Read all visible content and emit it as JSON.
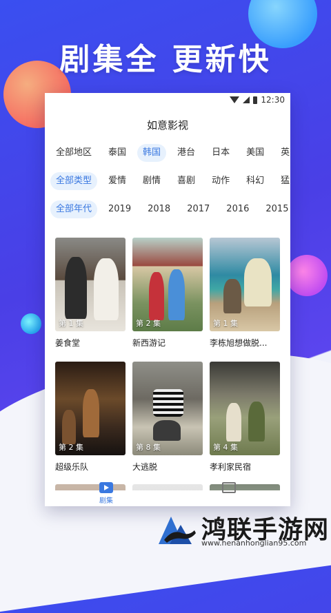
{
  "headline": "剧集全 更新快",
  "status": {
    "time": "12:30"
  },
  "app": {
    "title": "如意影视"
  },
  "filters": {
    "region": [
      "全部地区",
      "泰国",
      "韩国",
      "港台",
      "日本",
      "美国",
      "英"
    ],
    "region_active": "韩国",
    "genre": [
      "全部类型",
      "爱情",
      "剧情",
      "喜剧",
      "动作",
      "科幻",
      "猛"
    ],
    "genre_active": "全部类型",
    "year": [
      "全部年代",
      "2019",
      "2018",
      "2017",
      "2016",
      "2015"
    ],
    "year_active": "全部年代"
  },
  "cards": [
    {
      "title": "姜食堂",
      "episode": "第 1 集"
    },
    {
      "title": "新西游记",
      "episode": "第 2 集"
    },
    {
      "title": "李栋旭想做脱...",
      "episode": "第 1 集"
    },
    {
      "title": "超级乐队",
      "episode": "第 2 集"
    },
    {
      "title": "大逃脱",
      "episode": "第 8 集"
    },
    {
      "title": "孝利家民宿",
      "episode": "第 4 集"
    }
  ],
  "bottom_nav": {
    "tab1_label": "剧集"
  },
  "watermark": {
    "name": "鸿联手游网",
    "url": "www.henanhonglian95.com"
  }
}
